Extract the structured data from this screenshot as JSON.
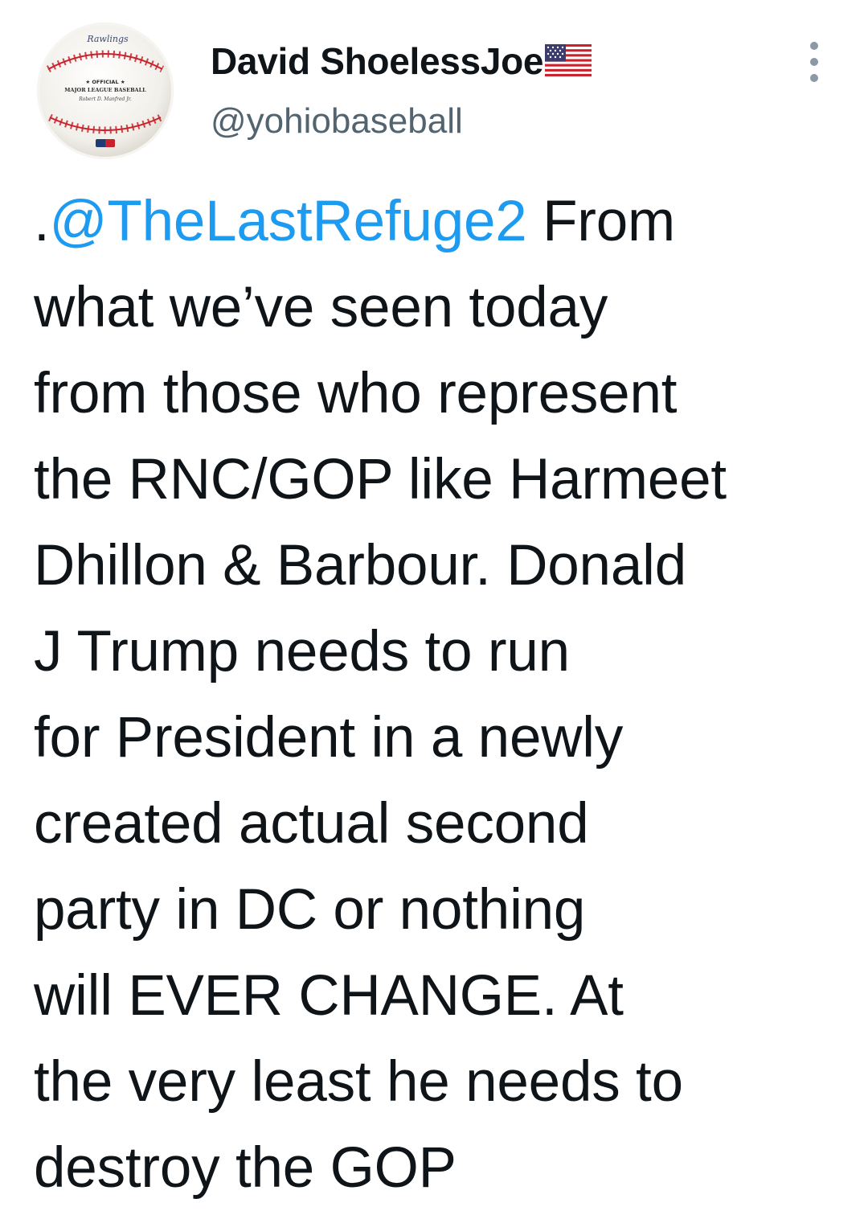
{
  "user": {
    "display_name": "David ShoelessJoe",
    "handle": "@yohiobaseball",
    "flag_icon": "us-flag-icon",
    "avatar": {
      "icon": "baseball-avatar-icon",
      "brand_text": "Rawlings",
      "ball_text_line1": "★ OFFICIAL ★",
      "ball_text_line2": "MAJOR LEAGUE BASEBALL",
      "signature": "Robert D. Manfred Jr."
    }
  },
  "more_button": {
    "icon": "more-vertical-icon"
  },
  "tweet": {
    "mention": "@TheLastRefuge2",
    "lines": [
      {
        "prefix": ".",
        "text": " From"
      },
      {
        "text": "what we’ve seen today"
      },
      {
        "text": "from those who represent"
      },
      {
        "text": "the RNC/GOP like Harmeet"
      },
      {
        "text": "Dhillon & Barbour. Donald"
      },
      {
        "text": "J Trump needs to run"
      },
      {
        "text": "for President in a newly"
      },
      {
        "text": "created actual second"
      },
      {
        "text": "party in DC or nothing"
      },
      {
        "text": "will EVER CHANGE. At"
      },
      {
        "text": "the very least he needs to"
      },
      {
        "text": "destroy the GOP"
      }
    ]
  },
  "colors": {
    "text": "#0f1419",
    "secondary_text": "#536471",
    "link": "#1d9bf0",
    "background": "#ffffff"
  }
}
